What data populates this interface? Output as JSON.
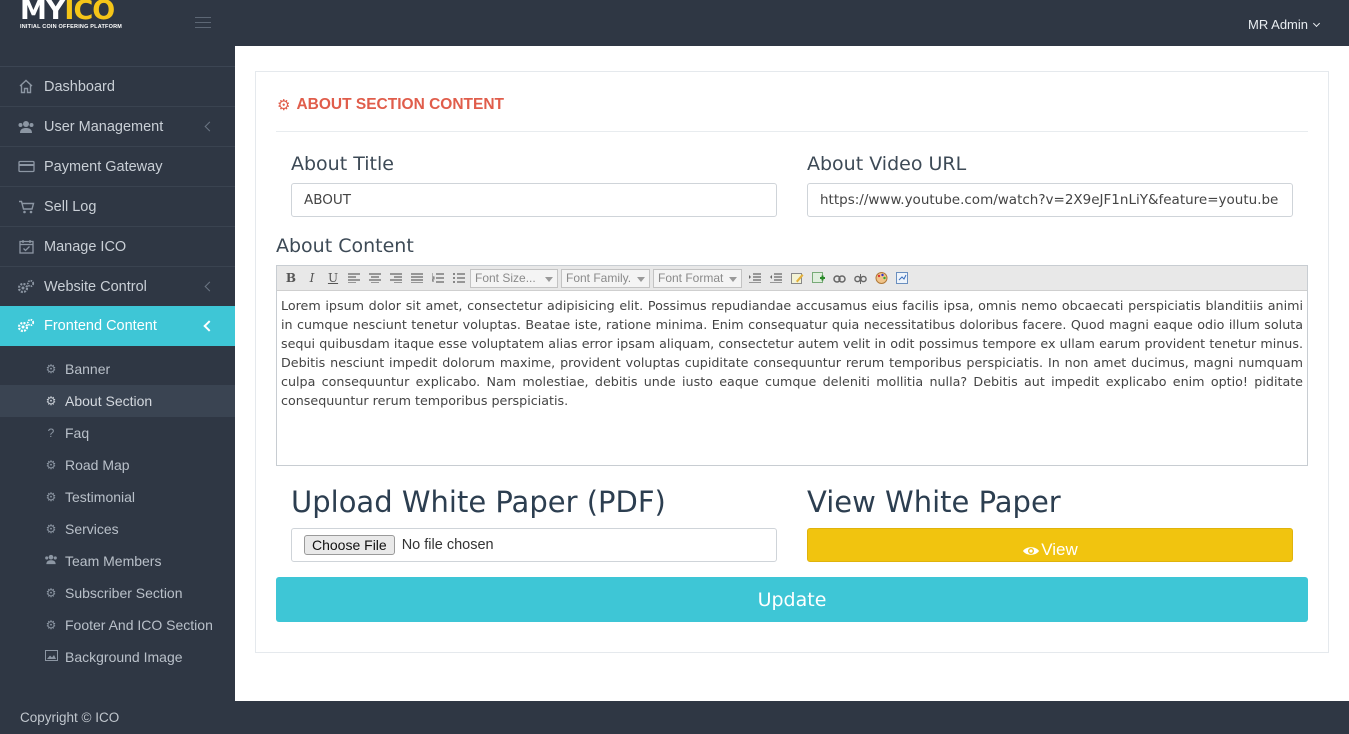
{
  "header": {
    "logo_main_prefix": "MY",
    "logo_main_accent": "ICO",
    "logo_tagline": "INITIAL COIN OFFERING PLATFORM",
    "user_name": "MR Admin"
  },
  "sidebar": {
    "items": [
      {
        "label": "Dashboard",
        "icon": "home-icon"
      },
      {
        "label": "User Management",
        "icon": "users-icon"
      },
      {
        "label": "Payment Gateway",
        "icon": "credit-card-icon"
      },
      {
        "label": "Sell Log",
        "icon": "cart-icon"
      },
      {
        "label": "Manage ICO",
        "icon": "calendar-check-icon"
      },
      {
        "label": "Website Control",
        "icon": "cogs-icon"
      },
      {
        "label": "Frontend Content",
        "icon": "cogs-icon"
      }
    ],
    "subitems": [
      {
        "label": "Banner",
        "icon": "gear-icon"
      },
      {
        "label": "About Section",
        "icon": "gear-icon"
      },
      {
        "label": "Faq",
        "icon": "question-icon"
      },
      {
        "label": "Road Map",
        "icon": "gear-icon"
      },
      {
        "label": "Testimonial",
        "icon": "gear-icon"
      },
      {
        "label": "Services",
        "icon": "gear-icon"
      },
      {
        "label": "Team Members",
        "icon": "users-icon"
      },
      {
        "label": "Subscriber Section",
        "icon": "gear-icon"
      },
      {
        "label": "Footer And ICO Section",
        "icon": "gear-icon"
      },
      {
        "label": "Background Image",
        "icon": "image-icon"
      }
    ]
  },
  "card": {
    "title": "ABOUT SECTION CONTENT",
    "about_title_label": "About Title",
    "about_title_value": "ABOUT",
    "video_url_label": "About Video URL",
    "video_url_value": "https://www.youtube.com/watch?v=2X9eJF1nLiY&feature=youtu.be",
    "about_content_label": "About Content",
    "about_content_value": "Lorem ipsum dolor sit amet, consectetur adipisicing elit. Possimus repudiandae accusamus eius facilis ipsa, omnis nemo obcaecati perspiciatis blanditiis animi in cumque nesciunt tenetur voluptas. Beatae iste, ratione minima. Enim consequatur quia necessitatibus doloribus facere. Quod magni eaque odio illum soluta sequi quibusdam itaque esse voluptatem alias error ipsam aliquam, consectetur autem velit in odit possimus tempore ex ullam earum provident tenetur minus. Debitis nesciunt impedit dolorum maxime, provident voluptas cupiditate consequuntur rerum temporibus perspiciatis. In non amet ducimus, magni numquam culpa consequuntur explicabo. Nam molestiae, debitis unde iusto eaque cumque deleniti mollitia nulla? Debitis aut impedit explicabo enim optio! piditate consequuntur rerum temporibus perspiciatis.",
    "toolbar": {
      "font_size": "Font Size...",
      "font_family": "Font Family.",
      "font_format": "Font Format"
    },
    "upload_label": "Upload White Paper (PDF)",
    "choose_file_label": "Choose File",
    "no_file_text": "No file chosen",
    "view_label": "View White Paper",
    "view_button": "View",
    "update_button": "Update"
  },
  "footer": {
    "copyright": "Copyright © ICO"
  },
  "colors": {
    "sidebar_bg": "#2f3744",
    "accent_cyan": "#3ec6d6",
    "title_red": "#e05d4b",
    "view_yellow": "#f1c40f"
  }
}
